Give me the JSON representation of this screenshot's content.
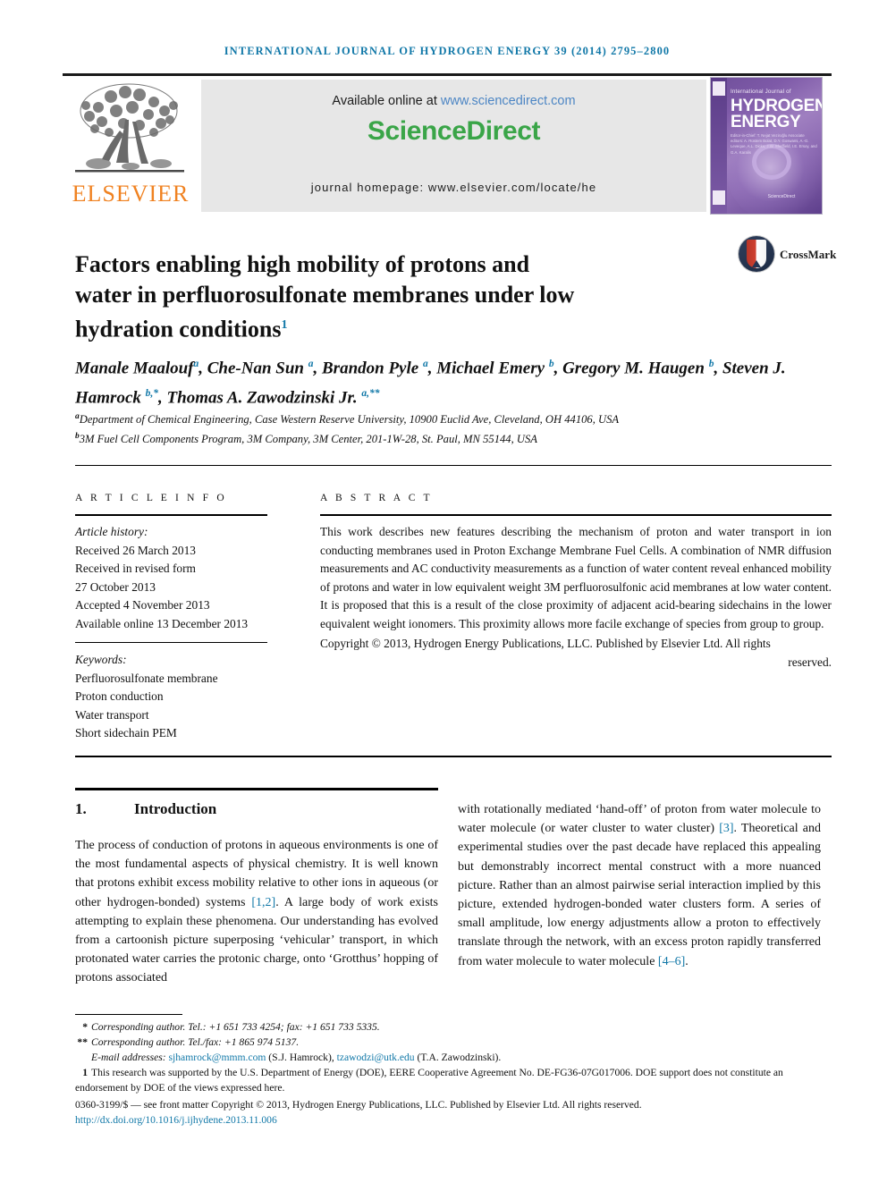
{
  "running_head": "INTERNATIONAL JOURNAL OF HYDROGEN ENERGY 39 (2014) 2795–2800",
  "masthead": {
    "publisher_logo_text": "ELSEVIER",
    "available_prefix": "Available online at ",
    "available_url": "www.sciencedirect.com",
    "sciencedirect_logo": "ScienceDirect",
    "journal_homepage": "journal homepage: www.elsevier.com/locate/he",
    "cover": {
      "small_line": "International Journal of",
      "big_line1": "HYDROGEN",
      "big_line2": "ENERGY",
      "editors": "Editor-in-Chief: T. Nejat Veziroğlu  Associate editors: A. Rüstem Bolat, D.Y. Goswami, A.-G. Leveque, A.L. Dicks, J.W. Sheffield, I.E. Ersoy, and G.A. Karalis",
      "sd_mark": "ScienceDirect"
    }
  },
  "article": {
    "title_line1": "Factors enabling high mobility of protons and",
    "title_line2": "water in perfluorosulfonate membranes under low",
    "title_line3": "hydration conditions",
    "title_footnote_mark": "1",
    "crossmark_label": "CrossMark",
    "authors_html": "Manale Maalouf<sup>a</sup>, Che-Nan Sun <sup>a</sup>, Brandon Pyle <sup>a</sup>, Michael Emery <sup>b</sup>, Gregory M. Haugen <sup>b</sup>, Steven J. Hamrock <sup>b,*</sup>, Thomas A. Zawodzinski Jr. <sup>a,**</sup>",
    "affiliations": [
      "Department of Chemical Engineering, Case Western Reserve University, 10900 Euclid Ave, Cleveland, OH 44106, USA",
      "3M Fuel Cell Components Program, 3M Company, 3M Center, 201-1W-28, St. Paul, MN 55144, USA"
    ],
    "affiliation_marks": [
      "a",
      "b"
    ]
  },
  "article_info": {
    "heading": "A R T I C L E   I N F O",
    "history_label": "Article history:",
    "history": [
      "Received 26 March 2013",
      "Received in revised form",
      "27 October 2013",
      "Accepted 4 November 2013",
      "Available online 13 December 2013"
    ],
    "keywords_label": "Keywords:",
    "keywords": [
      "Perfluorosulfonate membrane",
      "Proton conduction",
      "Water transport",
      "Short sidechain PEM"
    ]
  },
  "abstract": {
    "heading": "A B S T R A C T",
    "body": "This work describes new features describing the mechanism of proton and water transport in ion conducting membranes used in Proton Exchange Membrane Fuel Cells. A combination of NMR diffusion measurements and AC conductivity measurements as a function of water content reveal enhanced mobility of protons and water in low equivalent weight 3M perfluorosulfonic acid membranes at low water content. It is proposed that this is a result of the close proximity of adjacent acid-bearing sidechains in the lower equivalent weight ionomers. This proximity allows more facile exchange of species from group to group.",
    "copyright": "Copyright © 2013, Hydrogen Energy Publications, LLC. Published by Elsevier Ltd. All rights",
    "copyright_tail": "reserved."
  },
  "section": {
    "number": "1.",
    "title": "Introduction",
    "left_column_html": "The process of conduction of protons in aqueous environments is one of the most fundamental aspects of physical chemistry. It is well known that protons exhibit excess mobility relative to other ions in aqueous (or other hydrogen-bonded) systems <span class=\"ref\">[1,2]</span>. A large body of work exists attempting to explain these phenomena. Our understanding has evolved from a cartoonish picture superposing ‘vehicular’ transport, in which protonated water carries the protonic charge, onto ‘Grotthus’ hopping of protons associated",
    "right_column_html": "with rotationally mediated ‘hand-off’ of proton from water molecule to water molecule (or water cluster to water cluster) <span class=\"ref\">[3]</span>. Theoretical and experimental studies over the past decade have replaced this appealing but demonstrably incorrect mental construct with a more nuanced picture. Rather than an almost pairwise serial interaction implied by this picture, extended hydrogen-bonded water clusters form. A series of small amplitude, low energy adjustments allow a proton to effectively translate through the network, with an excess proton rapidly transferred from water molecule to water molecule <span class=\"ref\">[4–6]</span>."
  },
  "footnotes": {
    "corresponding_1": "Corresponding author. Tel.: +1 651 733 4254; fax: +1 651 733 5335.",
    "corresponding_1_mark": "*",
    "corresponding_2": "Corresponding author. Tel./fax: +1 865 974 5137.",
    "corresponding_2_mark": "**",
    "email_label": "E-mail addresses: ",
    "email_1": "sjhamrock@mmm.com",
    "email_1_owner": " (S.J. Hamrock), ",
    "email_2": "tzawodzi@utk.edu",
    "email_2_owner": " (T.A. Zawodzinski).",
    "funding_mark": "1",
    "funding": "This research was supported by the U.S. Department of Energy (DOE), EERE Cooperative Agreement No. DE-FG36-07G017006. DOE support does not constitute an endorsement by DOE of the views expressed here.",
    "issn_line": "0360-3199/$ — see front matter Copyright © 2013, Hydrogen Energy Publications, LLC. Published by Elsevier Ltd. All rights reserved.",
    "doi": "http://dx.doi.org/10.1016/j.ijhydene.2013.11.006"
  },
  "colors": {
    "link": "#1178a8",
    "elsevier_orange": "#f08221",
    "sciencedirect_green": "#3aa548",
    "sd_link_blue": "#4d86c4"
  }
}
